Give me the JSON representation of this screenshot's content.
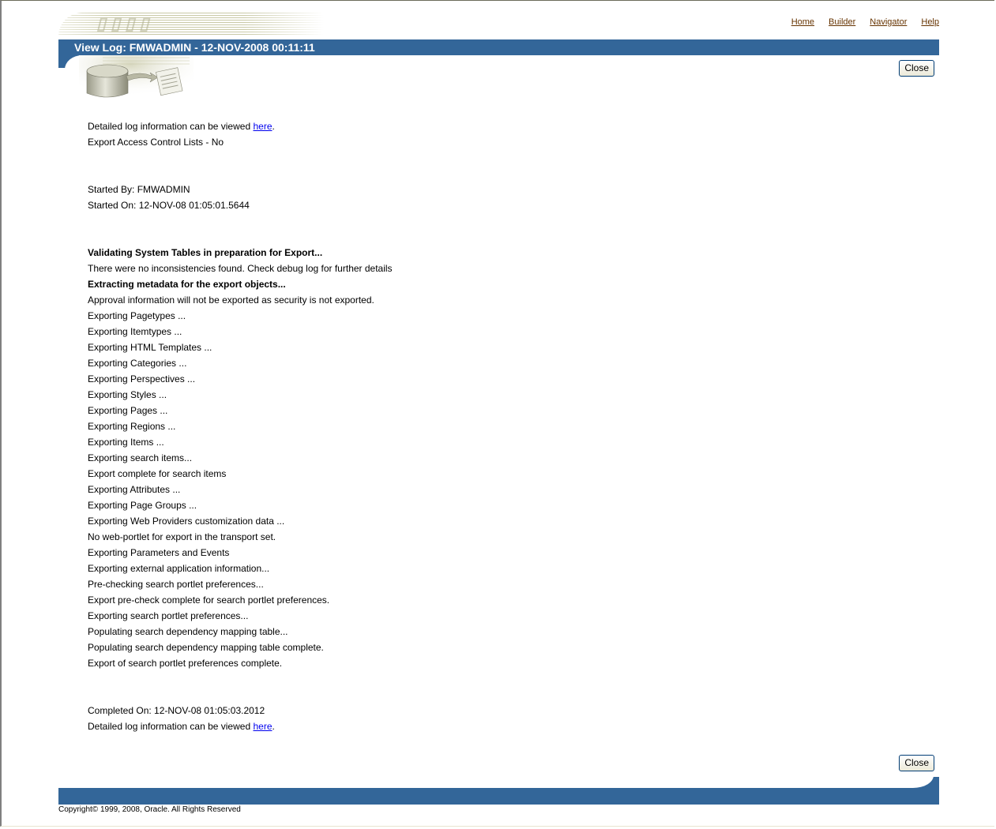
{
  "header": {
    "global_links": [
      {
        "label": "Home"
      },
      {
        "label": "Builder"
      },
      {
        "label": "Navigator"
      },
      {
        "label": "Help"
      }
    ],
    "page_title": "View Log: FMWADMIN - 12-NOV-2008 00:11:11",
    "close_label": "Close"
  },
  "log": {
    "intro_prefix": "Detailed log information can be viewed ",
    "intro_link": "here",
    "intro_suffix": ".",
    "acl": "Export Access Control Lists - No",
    "started_by": "Started By: FMWADMIN",
    "started_on": "Started On: 12-NOV-08 01:05:01.5644",
    "entries": [
      {
        "text": "Validating System Tables in preparation for Export...",
        "bold": true
      },
      {
        "text": "There were no inconsistencies found. Check debug log for further details",
        "bold": false
      },
      {
        "text": "Extracting metadata for the export objects...",
        "bold": true
      },
      {
        "text": "Approval information will not be exported as security is not exported.",
        "bold": false
      },
      {
        "text": "Exporting Pagetypes ...",
        "bold": false
      },
      {
        "text": "Exporting Itemtypes ...",
        "bold": false
      },
      {
        "text": "Exporting HTML Templates ...",
        "bold": false
      },
      {
        "text": "Exporting Categories ...",
        "bold": false
      },
      {
        "text": "Exporting Perspectives ...",
        "bold": false
      },
      {
        "text": "Exporting Styles ...",
        "bold": false
      },
      {
        "text": "Exporting Pages ...",
        "bold": false
      },
      {
        "text": "Exporting Regions ...",
        "bold": false
      },
      {
        "text": "Exporting Items ...",
        "bold": false
      },
      {
        "text": "Exporting search items...",
        "bold": false
      },
      {
        "text": "Export complete for search items",
        "bold": false
      },
      {
        "text": "Exporting Attributes ...",
        "bold": false
      },
      {
        "text": "Exporting Page Groups ...",
        "bold": false
      },
      {
        "text": "Exporting Web Providers customization data ...",
        "bold": false
      },
      {
        "text": "No web-portlet for export in the transport set.",
        "bold": false
      },
      {
        "text": "Exporting Parameters and Events",
        "bold": false
      },
      {
        "text": "Exporting external application information...",
        "bold": false
      },
      {
        "text": "Pre-checking search portlet preferences...",
        "bold": false
      },
      {
        "text": "Export pre-check complete for search portlet preferences.",
        "bold": false
      },
      {
        "text": "Exporting search portlet preferences...",
        "bold": false
      },
      {
        "text": "Populating search dependency mapping table...",
        "bold": false
      },
      {
        "text": "Populating search dependency mapping table complete.",
        "bold": false
      },
      {
        "text": "Export of search portlet preferences complete.",
        "bold": false
      }
    ],
    "completed_on": "Completed On: 12-NOV-08 01:05:03.2012",
    "outro_prefix": "Detailed log information can be viewed ",
    "outro_link": "here",
    "outro_suffix": "."
  },
  "footer": {
    "copyright": "Copyright© 1999, 2008, Oracle. All Rights Reserved"
  },
  "colors": {
    "brand_bar": "#336699",
    "global_link": "#663300",
    "hyperlink": "#0000ee"
  },
  "icons": {
    "banner_logo": "portal-logo-icon",
    "page_icon": "database-export-icon"
  }
}
